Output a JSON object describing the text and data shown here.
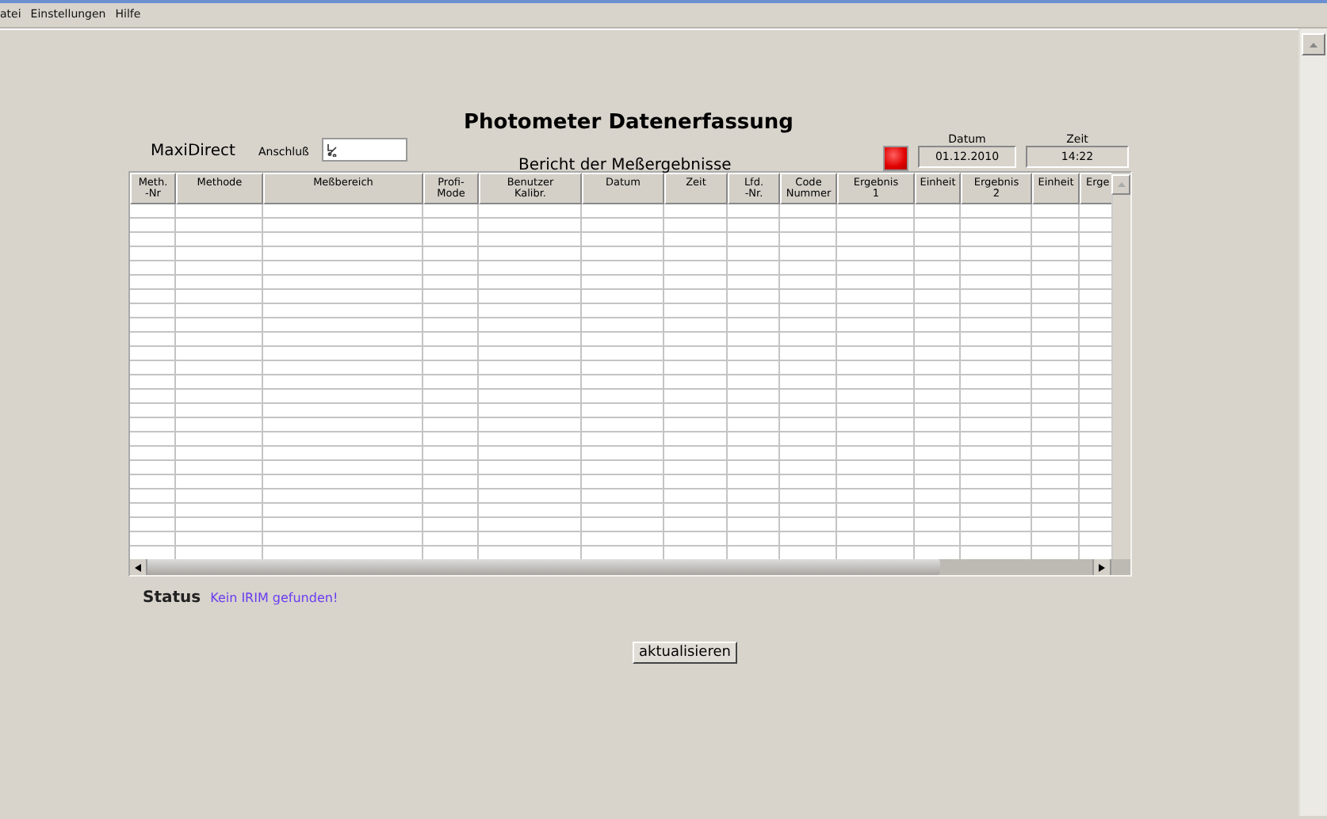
{
  "menu": [
    {
      "label": "atei"
    },
    {
      "label": "Einstellungen"
    },
    {
      "label": "Hilfe"
    }
  ],
  "title": "Photometer Datenerfassung",
  "device": {
    "name": "MaxiDirect",
    "port_label": "Anschluß"
  },
  "report_title": "Bericht der Meßergebnisse",
  "indicator": {
    "on": true
  },
  "date": {
    "label": "Datum",
    "value": "01.12.2010"
  },
  "time": {
    "label": "Zeit",
    "value": "14:22"
  },
  "table": {
    "columns": [
      [
        "Meth.",
        "-Nr"
      ],
      [
        "Methode"
      ],
      [
        "Meßbereich"
      ],
      [
        "Profi-",
        "Mode"
      ],
      [
        "Benutzer",
        "Kalibr."
      ],
      [
        "Datum"
      ],
      [
        "Zeit"
      ],
      [
        "Lfd.",
        "-Nr."
      ],
      [
        "Code",
        "Nummer"
      ],
      [
        "Ergebnis",
        "1"
      ],
      [
        "Einheit"
      ],
      [
        "Ergebnis",
        "2"
      ],
      [
        "Einheit"
      ],
      [
        "Erge"
      ]
    ]
  },
  "status": {
    "label": "Status",
    "message": "Kein IRIM gefunden!"
  },
  "buttons": [
    {
      "label": "aktualisieren"
    }
  ]
}
